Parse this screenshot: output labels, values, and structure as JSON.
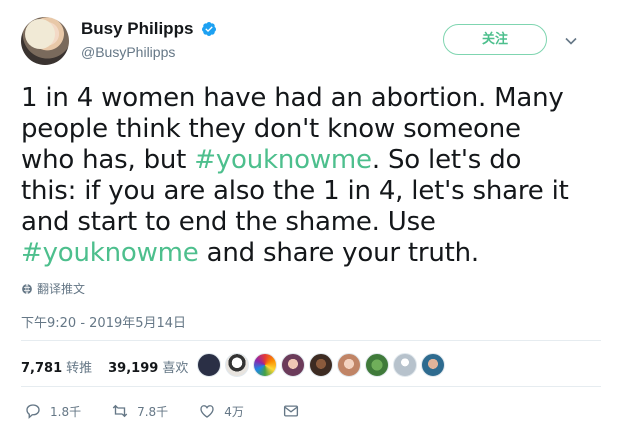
{
  "author": {
    "name": "Busy Philipps",
    "handle": "@BusyPhilipps",
    "verified": true
  },
  "follow_label": "关注",
  "tweet": {
    "segments": [
      {
        "text": "1 in 4 women have had an abortion. Many people think they don't know someone who has, but ",
        "type": "text"
      },
      {
        "text": "#youknowme",
        "type": "hashtag"
      },
      {
        "text": ". So let's do this: if you are also the 1 in 4, let's share it and start to end the shame. Use ",
        "type": "text"
      },
      {
        "text": "#youknowme",
        "type": "hashtag"
      },
      {
        "text": " and share your truth.",
        "type": "text"
      }
    ]
  },
  "translate_label": "翻译推文",
  "timestamp": "下午9:20 - 2019年5月14日",
  "stats": {
    "retweets_count": "7,781",
    "retweets_label": "转推",
    "likes_count": "39,199",
    "likes_label": "喜欢"
  },
  "actions": {
    "reply_count": "1.8千",
    "retweet_count": "7.8千",
    "like_count": "4万"
  },
  "colors": {
    "accent": "#4dbf8d",
    "text": "#14171a",
    "muted": "#657786",
    "verified": "#1da1f2"
  },
  "liker_avatars": [
    "#2a2f45",
    "#e8e4df",
    "#d9a33a",
    "#6b3b5a",
    "#3d2b22",
    "#c08466",
    "#3f7a3a",
    "#b7c2cc",
    "#2e6b8f"
  ]
}
